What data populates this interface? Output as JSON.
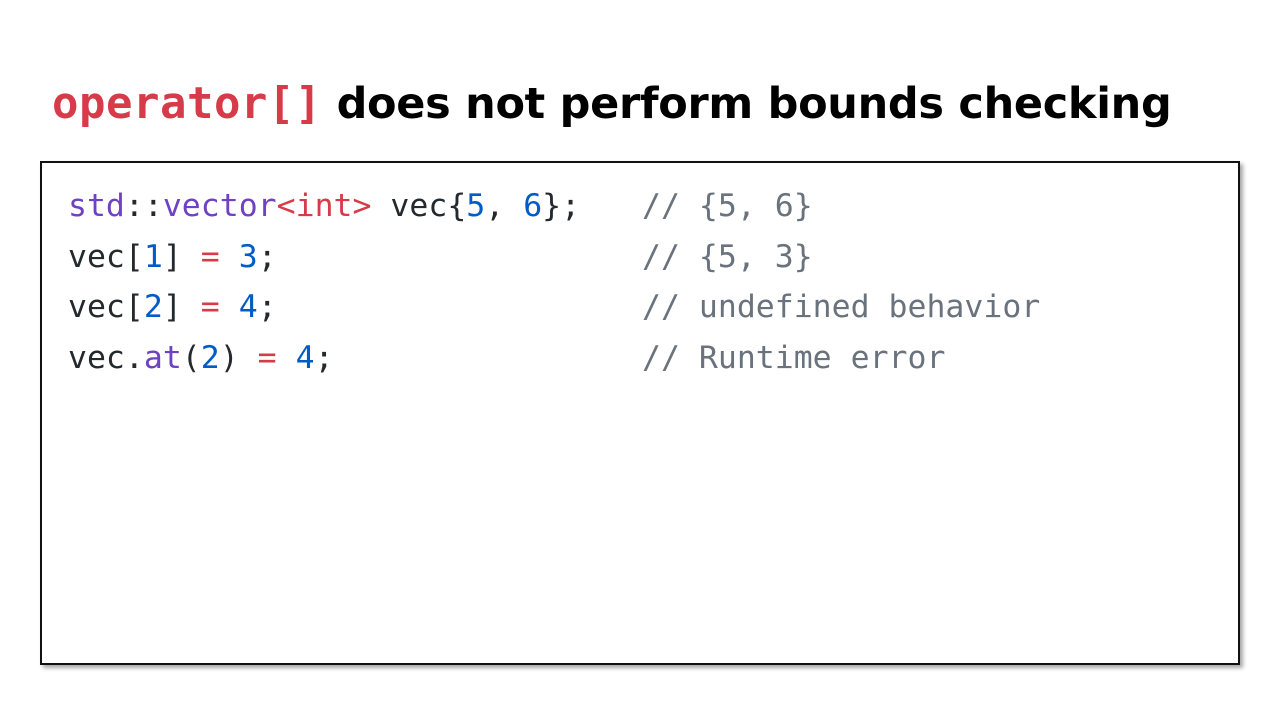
{
  "title": {
    "code": "operator[]",
    "text": " does not perform bounds checking"
  },
  "colors": {
    "keyword_purple": "#6f42c1",
    "operator_red": "#d73a49",
    "number_blue": "#005cc5",
    "plain_text": "#24292e",
    "comment_gray": "#6a737d"
  },
  "code": {
    "lines": [
      {
        "tokens": [
          {
            "text": "std",
            "color": "#6f42c1"
          },
          {
            "text": "::",
            "color": "#24292e"
          },
          {
            "text": "vector",
            "color": "#6f42c1"
          },
          {
            "text": "<int>",
            "color": "#d73a49"
          },
          {
            "text": " vec",
            "color": "#24292e"
          },
          {
            "text": "{",
            "color": "#24292e"
          },
          {
            "text": "5",
            "color": "#005cc5"
          },
          {
            "text": ", ",
            "color": "#24292e"
          },
          {
            "text": "6",
            "color": "#005cc5"
          },
          {
            "text": "};",
            "color": "#24292e"
          }
        ],
        "comment": "// {5, 6}"
      },
      {
        "tokens": [
          {
            "text": "vec",
            "color": "#24292e"
          },
          {
            "text": "[",
            "color": "#24292e"
          },
          {
            "text": "1",
            "color": "#005cc5"
          },
          {
            "text": "] ",
            "color": "#24292e"
          },
          {
            "text": "=",
            "color": "#d73a49"
          },
          {
            "text": " ",
            "color": "#24292e"
          },
          {
            "text": "3",
            "color": "#005cc5"
          },
          {
            "text": ";",
            "color": "#24292e"
          }
        ],
        "comment": "// {5, 3}"
      },
      {
        "tokens": [
          {
            "text": "vec",
            "color": "#24292e"
          },
          {
            "text": "[",
            "color": "#24292e"
          },
          {
            "text": "2",
            "color": "#005cc5"
          },
          {
            "text": "] ",
            "color": "#24292e"
          },
          {
            "text": "=",
            "color": "#d73a49"
          },
          {
            "text": " ",
            "color": "#24292e"
          },
          {
            "text": "4",
            "color": "#005cc5"
          },
          {
            "text": ";",
            "color": "#24292e"
          }
        ],
        "comment": "// undefined behavior"
      },
      {
        "tokens": [
          {
            "text": "vec.",
            "color": "#24292e"
          },
          {
            "text": "at",
            "color": "#6f42c1"
          },
          {
            "text": "(",
            "color": "#24292e"
          },
          {
            "text": "2",
            "color": "#005cc5"
          },
          {
            "text": ") ",
            "color": "#24292e"
          },
          {
            "text": "=",
            "color": "#d73a49"
          },
          {
            "text": " ",
            "color": "#24292e"
          },
          {
            "text": "4",
            "color": "#005cc5"
          },
          {
            "text": ";",
            "color": "#24292e"
          }
        ],
        "comment": "// Runtime error"
      }
    ]
  }
}
